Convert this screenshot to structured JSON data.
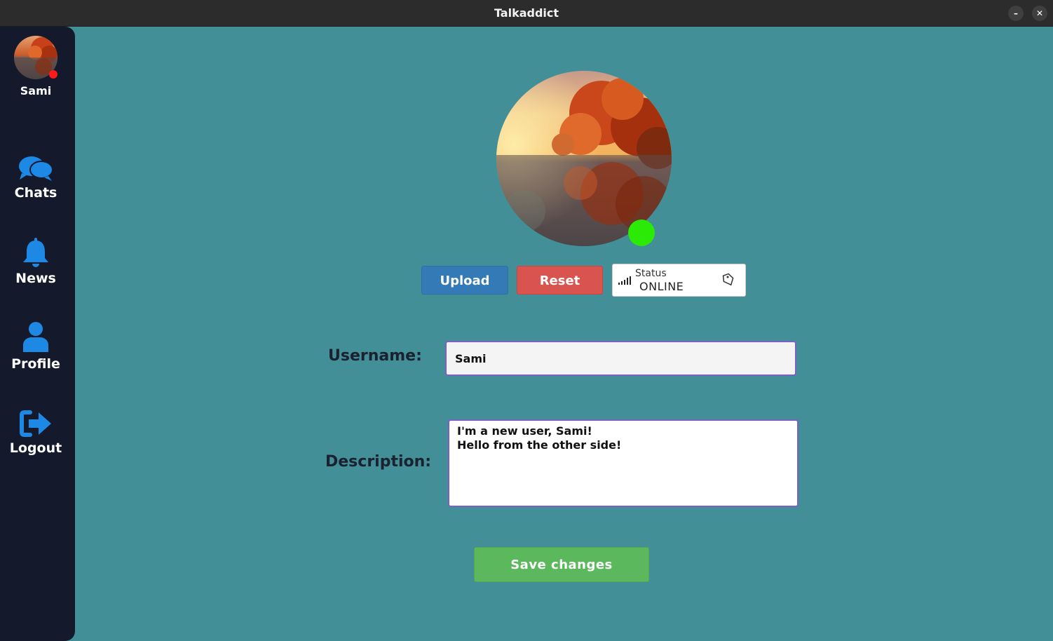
{
  "window": {
    "title": "Talkaddict",
    "minimize_icon": "minimize-icon",
    "close_icon": "close-icon"
  },
  "sidebar": {
    "user_name": "Sami",
    "user_status_color": "#ff1a1a",
    "items": [
      {
        "label": "Chats",
        "icon": "chat-bubbles-icon"
      },
      {
        "label": "News",
        "icon": "bell-icon"
      },
      {
        "label": "Profile",
        "icon": "user-icon"
      },
      {
        "label": "Logout",
        "icon": "logout-icon"
      }
    ],
    "accent_color": "#1e88e5"
  },
  "profile": {
    "avatar_status_color": "#2bea05",
    "upload_label": "Upload",
    "reset_label": "Reset",
    "status": {
      "caption": "Status",
      "value": "ONLINE"
    },
    "username_label": "Username:",
    "username_value": "Sami",
    "description_label": "Description:",
    "description_value": "I'm a new user, Sami!\nHello from the other side!",
    "save_label": "Save changes"
  },
  "colors": {
    "background": "#428f98",
    "sidebar": "#141a2b",
    "upload": "#337ab7",
    "reset": "#d9534f",
    "save": "#5cb85c"
  }
}
